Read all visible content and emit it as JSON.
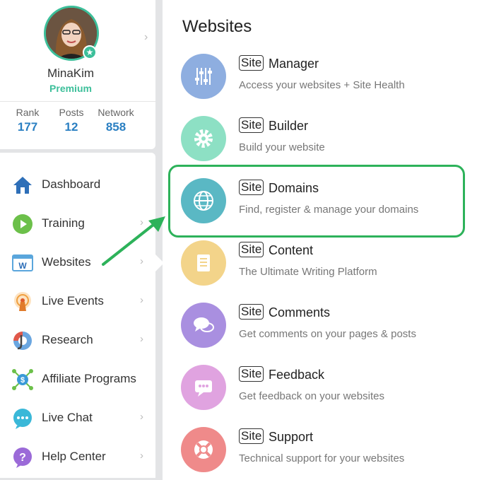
{
  "profile": {
    "username": "MinaKim",
    "level": "Premium",
    "stats": [
      {
        "label": "Rank",
        "value": "177"
      },
      {
        "label": "Posts",
        "value": "12"
      },
      {
        "label": "Network",
        "value": "858"
      }
    ]
  },
  "menu": [
    {
      "label": "Dashboard",
      "icon": "home-icon"
    },
    {
      "label": "Training",
      "icon": "play-icon"
    },
    {
      "label": "Websites",
      "icon": "website-icon"
    },
    {
      "label": "Live Events",
      "icon": "broadcast-icon"
    },
    {
      "label": "Research",
      "icon": "research-icon"
    },
    {
      "label": "Affiliate Programs",
      "icon": "affiliate-icon"
    },
    {
      "label": "Live Chat",
      "icon": "chat-icon"
    },
    {
      "label": "Help Center",
      "icon": "help-icon"
    }
  ],
  "panel": {
    "title": "Websites",
    "badge": "Site",
    "items": [
      {
        "name": "Manager",
        "desc": "Access your websites + Site Health",
        "color": "#8eaee0",
        "icon": "sliders-icon"
      },
      {
        "name": "Builder",
        "desc": "Build your website",
        "color": "#8de0c4",
        "icon": "gear-icon"
      },
      {
        "name": "Domains",
        "desc": "Find, register & manage your domains",
        "color": "#5ab8c4",
        "icon": "globe-icon"
      },
      {
        "name": "Content",
        "desc": "The Ultimate Writing Platform",
        "color": "#f3d48a",
        "icon": "document-icon"
      },
      {
        "name": "Comments",
        "desc": "Get comments on your pages & posts",
        "color": "#a98fe0",
        "icon": "comments-icon"
      },
      {
        "name": "Feedback",
        "desc": "Get feedback on your websites",
        "color": "#e0a3e0",
        "icon": "feedback-icon"
      },
      {
        "name": "Support",
        "desc": "Technical support for your websites",
        "color": "#ef8a8a",
        "icon": "lifebuoy-icon"
      }
    ]
  },
  "colors": {
    "accent": "#3cbf9a",
    "link": "#2a7fc2",
    "highlight": "#2db25a"
  }
}
